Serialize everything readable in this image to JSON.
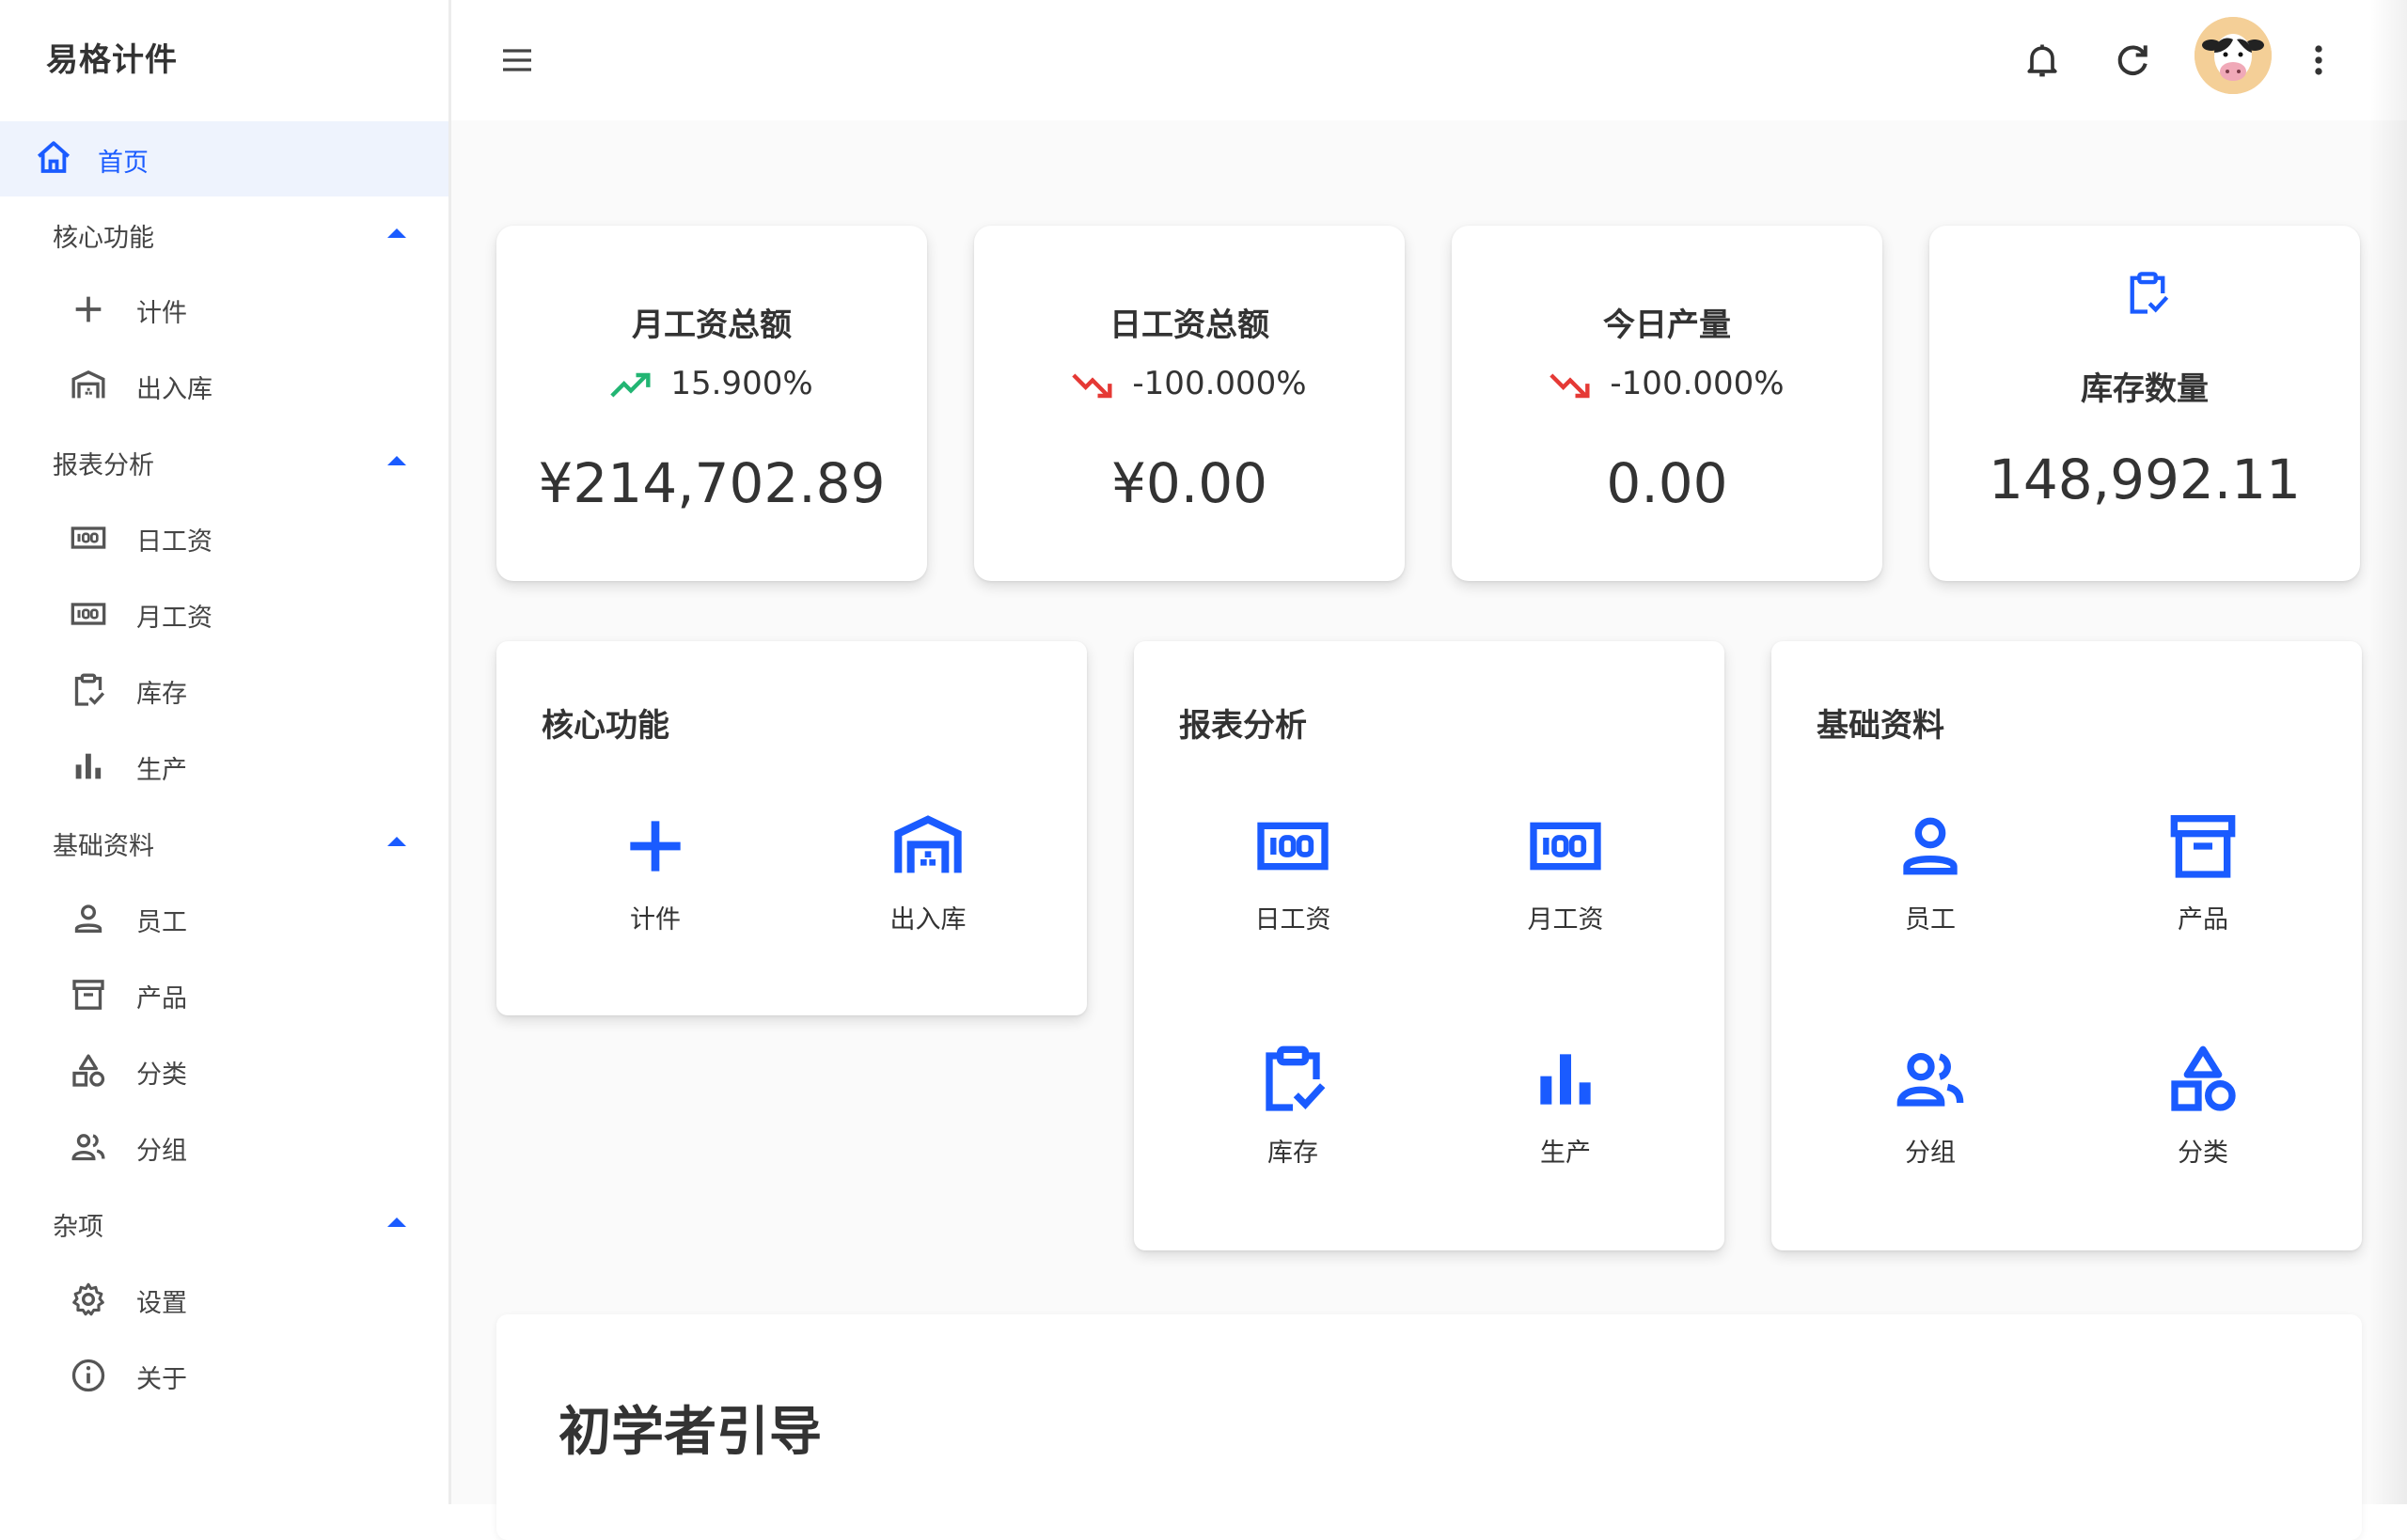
{
  "app": {
    "name": "易格计件"
  },
  "colors": {
    "accent": "#1a5bff",
    "up": "#22b573",
    "down": "#e53935"
  },
  "sidebar": {
    "home": "首页",
    "groups": [
      {
        "label": "核心功能",
        "items": [
          {
            "label": "计件",
            "icon": "plus-icon"
          },
          {
            "label": "出入库",
            "icon": "warehouse-icon"
          }
        ]
      },
      {
        "label": "报表分析",
        "items": [
          {
            "label": "日工资",
            "icon": "counter-icon"
          },
          {
            "label": "月工资",
            "icon": "counter-icon"
          },
          {
            "label": "库存",
            "icon": "clipboard-check-icon"
          },
          {
            "label": "生产",
            "icon": "bar-chart-icon"
          }
        ]
      },
      {
        "label": "基础资料",
        "items": [
          {
            "label": "员工",
            "icon": "person-icon"
          },
          {
            "label": "产品",
            "icon": "archive-icon"
          },
          {
            "label": "分类",
            "icon": "shapes-icon"
          },
          {
            "label": "分组",
            "icon": "people-icon"
          }
        ]
      },
      {
        "label": "杂项",
        "items": [
          {
            "label": "设置",
            "icon": "gear-icon"
          },
          {
            "label": "关于",
            "icon": "info-icon"
          }
        ]
      }
    ]
  },
  "stats": [
    {
      "title": "月工资总额",
      "trend": "15.900%",
      "trend_dir": "up",
      "value": "¥214,702.89"
    },
    {
      "title": "日工资总额",
      "trend": "-100.000%",
      "trend_dir": "down",
      "value": "¥0.00"
    },
    {
      "title": "今日产量",
      "trend": "-100.000%",
      "trend_dir": "down",
      "value": "0.00"
    },
    {
      "title": "库存数量",
      "value": "148,992.11"
    }
  ],
  "sections": [
    {
      "title": "核心功能",
      "tiles": [
        "计件",
        "出入库"
      ]
    },
    {
      "title": "报表分析",
      "tiles": [
        "日工资",
        "月工资",
        "库存",
        "生产"
      ]
    },
    {
      "title": "基础资料",
      "tiles": [
        "员工",
        "产品",
        "分组",
        "分类"
      ]
    }
  ],
  "guide": {
    "title": "初学者引导"
  }
}
